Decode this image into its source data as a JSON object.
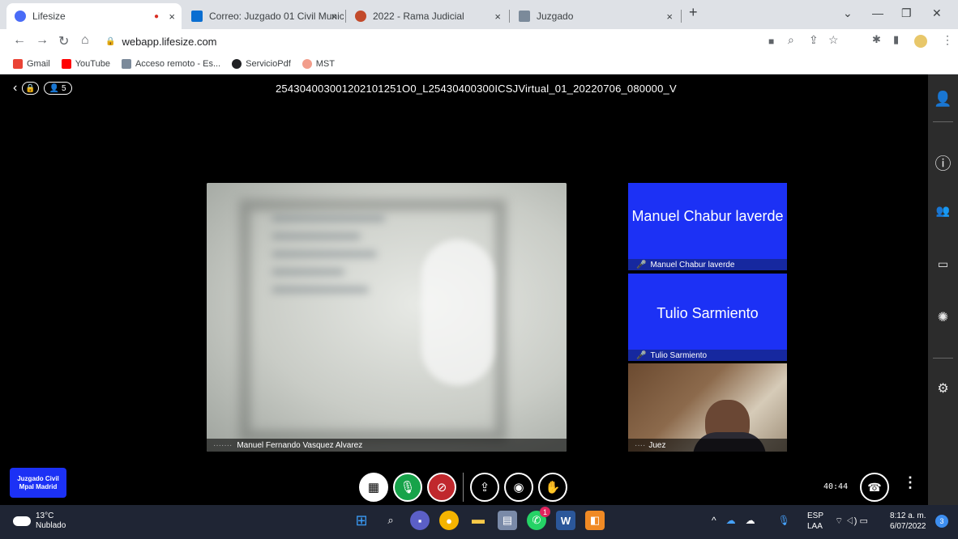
{
  "browser": {
    "tabs": [
      {
        "title": "Lifesize",
        "recording": "●",
        "close": "×"
      },
      {
        "title": "Correo: Juzgado 01 Civil Municip",
        "close": "×"
      },
      {
        "title": "2022 - Rama Judicial",
        "close": "×"
      },
      {
        "title": "Juzgado",
        "close": "×"
      }
    ],
    "new_tab": "+",
    "url": "webapp.lifesize.com",
    "bookmarks": [
      "Gmail",
      "YouTube",
      "Acceso remoto - Es...",
      "ServicioPdf",
      "MST"
    ]
  },
  "call": {
    "title": "254304003001202101251O0_L25430400300ICSJVirtual_01_20220706_080000_V",
    "participant_count": "5",
    "main_participant": "Manuel Fernando Vasquez Alvarez",
    "tiles": [
      {
        "display_name": "Manuel Chabur laverde",
        "label": "Manuel Chabur laverde"
      },
      {
        "display_name": "Tulio Sarmiento",
        "label": "Tulio Sarmiento"
      }
    ],
    "video_tile_label": "Juez",
    "timer": "40:44",
    "room_tag": "Juzgado Civil Mpal Madrid"
  },
  "taskbar": {
    "temperature": "13°C",
    "weather": "Nublado",
    "whatsapp_badge": "1",
    "lang_primary": "ESP",
    "lang_secondary": "LAA",
    "time": "8:12 a. m.",
    "date": "6/07/2022",
    "notification_count": "3"
  },
  "colors": {
    "tile_blue": "#1c31f5",
    "mic_green": "#17a34a",
    "cam_red": "#c0282d"
  }
}
